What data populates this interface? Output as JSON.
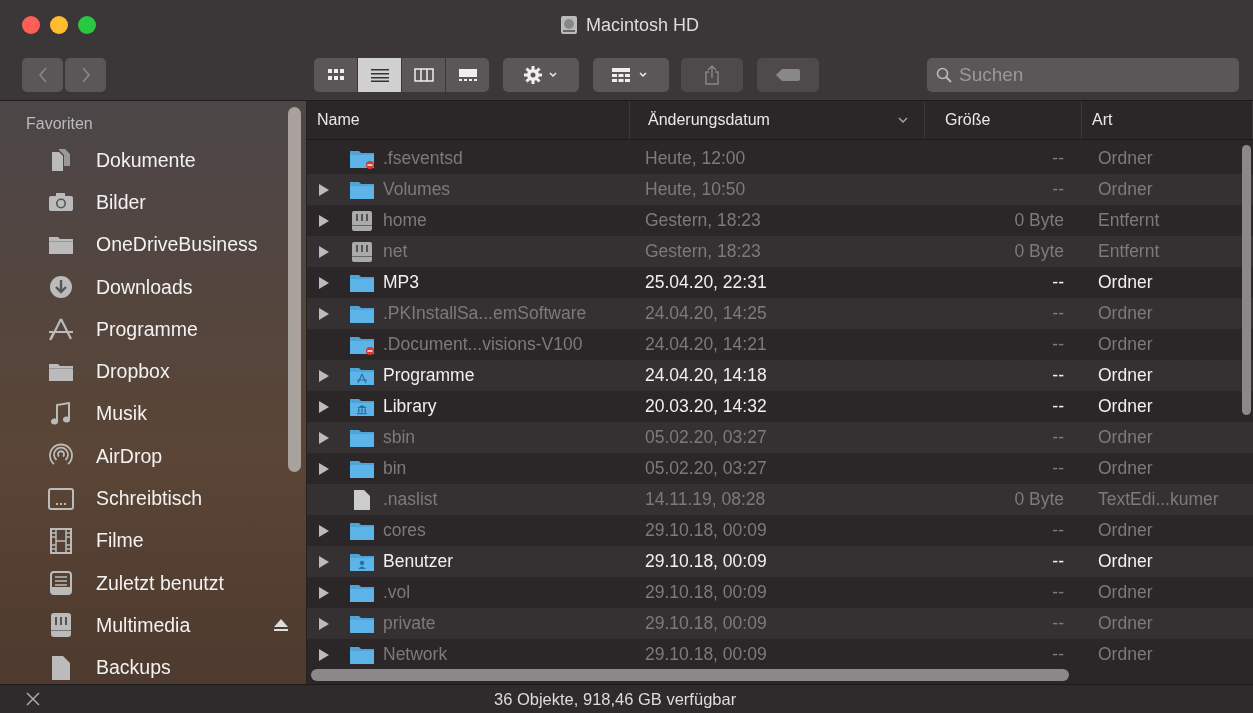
{
  "window": {
    "title": "Macintosh HD"
  },
  "toolbar": {
    "views": [
      {
        "kind": "icons",
        "selected": false
      },
      {
        "kind": "list",
        "selected": true
      },
      {
        "kind": "columns",
        "selected": false
      },
      {
        "kind": "gallery",
        "selected": false
      }
    ],
    "search": {
      "placeholder": "Suchen"
    }
  },
  "sidebar": {
    "heading": "Favoriten",
    "items": [
      {
        "label": "Dokumente",
        "kind": "documents",
        "eject": false
      },
      {
        "label": "Bilder",
        "kind": "camera",
        "eject": false
      },
      {
        "label": "OneDriveBusiness",
        "kind": "folder",
        "eject": false
      },
      {
        "label": "Downloads",
        "kind": "download",
        "eject": false
      },
      {
        "label": "Programme",
        "kind": "apps",
        "eject": false
      },
      {
        "label": "Dropbox",
        "kind": "folder",
        "eject": false
      },
      {
        "label": "Musik",
        "kind": "music",
        "eject": false
      },
      {
        "label": "AirDrop",
        "kind": "airdrop",
        "eject": false
      },
      {
        "label": "Schreibtisch",
        "kind": "desktop",
        "eject": false
      },
      {
        "label": "Filme",
        "kind": "film",
        "eject": false
      },
      {
        "label": "Zuletzt benutzt",
        "kind": "recents",
        "eject": false
      },
      {
        "label": "Multimedia",
        "kind": "drive",
        "eject": true
      },
      {
        "label": "Backups",
        "kind": "file",
        "eject": false
      }
    ]
  },
  "table": {
    "columns": [
      {
        "label": "Name",
        "sorted": false
      },
      {
        "label": "Änderungsdatum",
        "sorted": true
      },
      {
        "label": "Größe",
        "sorted": false
      },
      {
        "label": "Art",
        "sorted": false
      }
    ],
    "rows": [
      {
        "name": ".fseventsd",
        "date": "Heute, 12:00",
        "size": "--",
        "type": "Ordner",
        "kind": "restricted",
        "dimmed": true,
        "expandable": false
      },
      {
        "name": "Volumes",
        "date": "Heute, 10:50",
        "size": "--",
        "type": "Ordner",
        "kind": "folder",
        "dimmed": true,
        "expandable": true
      },
      {
        "name": "home",
        "date": "Gestern, 18:23",
        "size": "0 Byte",
        "type": "Entfernt",
        "kind": "drive",
        "dimmed": true,
        "expandable": true
      },
      {
        "name": "net",
        "date": "Gestern, 18:23",
        "size": "0 Byte",
        "type": "Entfernt",
        "kind": "drive",
        "dimmed": true,
        "expandable": true
      },
      {
        "name": "MP3",
        "date": "25.04.20, 22:31",
        "size": "--",
        "type": "Ordner",
        "kind": "folder",
        "dimmed": false,
        "expandable": true
      },
      {
        "name": ".PKInstallSa...emSoftware",
        "date": "24.04.20, 14:25",
        "size": "--",
        "type": "Ordner",
        "kind": "folder",
        "dimmed": true,
        "expandable": true
      },
      {
        "name": ".Document...visions-V100",
        "date": "24.04.20, 14:21",
        "size": "--",
        "type": "Ordner",
        "kind": "restricted",
        "dimmed": true,
        "expandable": false
      },
      {
        "name": "Programme",
        "date": "24.04.20, 14:18",
        "size": "--",
        "type": "Ordner",
        "kind": "apps",
        "dimmed": false,
        "expandable": true
      },
      {
        "name": "Library",
        "date": "20.03.20, 14:32",
        "size": "--",
        "type": "Ordner",
        "kind": "library",
        "dimmed": false,
        "expandable": true
      },
      {
        "name": "sbin",
        "date": "05.02.20, 03:27",
        "size": "--",
        "type": "Ordner",
        "kind": "folder",
        "dimmed": true,
        "expandable": true
      },
      {
        "name": "bin",
        "date": "05.02.20, 03:27",
        "size": "--",
        "type": "Ordner",
        "kind": "folder",
        "dimmed": true,
        "expandable": true
      },
      {
        "name": ".naslist",
        "date": "14.11.19, 08:28",
        "size": "0 Byte",
        "type": "TextEdi...kumer",
        "kind": "file",
        "dimmed": true,
        "expandable": false
      },
      {
        "name": "cores",
        "date": "29.10.18, 00:09",
        "size": "--",
        "type": "Ordner",
        "kind": "folder",
        "dimmed": true,
        "expandable": true
      },
      {
        "name": "Benutzer",
        "date": "29.10.18, 00:09",
        "size": "--",
        "type": "Ordner",
        "kind": "user",
        "dimmed": false,
        "expandable": true
      },
      {
        "name": ".vol",
        "date": "29.10.18, 00:09",
        "size": "--",
        "type": "Ordner",
        "kind": "folder",
        "dimmed": true,
        "expandable": true
      },
      {
        "name": "private",
        "date": "29.10.18, 00:09",
        "size": "--",
        "type": "Ordner",
        "kind": "folder",
        "dimmed": true,
        "expandable": true
      },
      {
        "name": "Network",
        "date": "29.10.18, 00:09",
        "size": "--",
        "type": "Ordner",
        "kind": "folder",
        "dimmed": true,
        "expandable": true
      }
    ]
  },
  "status_bar": {
    "text": "36 Objekte, 918,46 GB verfügbar"
  }
}
